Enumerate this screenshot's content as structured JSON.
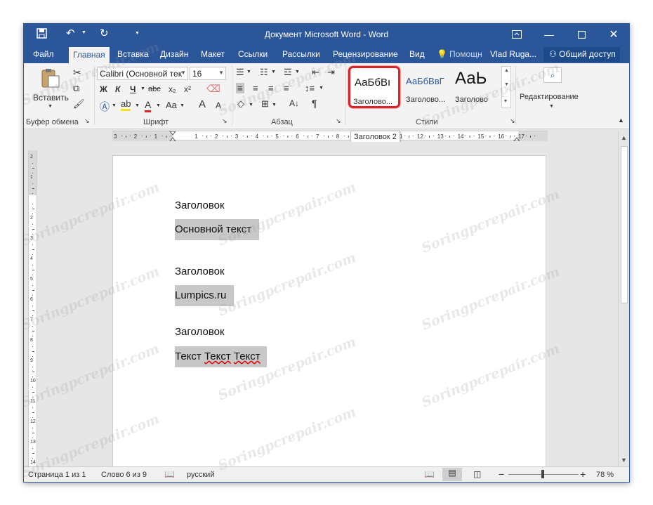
{
  "window": {
    "title": "Документ Microsoft Word - Word",
    "quick_access": {
      "save_icon": "save-icon",
      "undo_icon": "undo-icon",
      "redo_icon": "redo-icon",
      "customize": "▼"
    },
    "controls": {
      "ribbon_options": "ribbon-display-icon",
      "minimize": "minimize-icon",
      "maximize": "maximize-icon",
      "close": "close-icon"
    }
  },
  "tabs": [
    {
      "label": "Файл"
    },
    {
      "label": "Главная"
    },
    {
      "label": "Вставка"
    },
    {
      "label": "Дизайн"
    },
    {
      "label": "Макет"
    },
    {
      "label": "Ссылки"
    },
    {
      "label": "Рассылки"
    },
    {
      "label": "Рецензирование"
    },
    {
      "label": "Вид"
    },
    {
      "label": "Помощн"
    }
  ],
  "user": "Vlad Ruga...",
  "share": "Общий доступ",
  "ribbon": {
    "clipboard": {
      "paste_label": "Вставить",
      "group_label": "Буфер обмена"
    },
    "font": {
      "font_name": "Calibri (Основной тек",
      "font_size": "16",
      "bold": "Ж",
      "italic": "К",
      "underline": "Ч",
      "strike": "abc",
      "subscript": "x₂",
      "superscript": "x²",
      "font_color_letter": "A",
      "case": "Aa",
      "grow": "A",
      "shrink": "A",
      "group_label": "Шрифт"
    },
    "paragraph": {
      "group_label": "Абзац",
      "pilcrow": "¶"
    },
    "styles": {
      "items": [
        {
          "preview": "АаБбВı",
          "name": "Заголово..."
        },
        {
          "preview": "АаБбВвГ",
          "name": "Заголово..."
        },
        {
          "preview": "АаЬ",
          "name": "Заголово"
        }
      ],
      "group_label": "Стили",
      "tooltip": "Заголовок 2"
    },
    "editing": {
      "label": "Редактирование"
    }
  },
  "ruler_numbers": [
    "3",
    "2",
    "1",
    "1",
    "2",
    "3",
    "4",
    "5",
    "6",
    "7",
    "8",
    "9",
    "10",
    "11",
    "12",
    "13",
    "14",
    "15",
    "16",
    "17"
  ],
  "document": {
    "blocks": [
      {
        "heading": "Заголовок",
        "body": "Основной текст"
      },
      {
        "heading": "Заголовок",
        "body": "Lumpics.ru"
      },
      {
        "heading": "Заголовок",
        "body_words": [
          "Текст",
          "Текст",
          "Текст"
        ]
      }
    ]
  },
  "statusbar": {
    "page": "Страница 1 из 1",
    "words": "Слово 6 из 9",
    "language": "русский",
    "zoom_percent": "78 %",
    "zoom_level": 0.49
  },
  "watermark": "Soringpcrepair.com",
  "colors": {
    "accent": "#2b579a",
    "highlight": "#d9252a"
  }
}
